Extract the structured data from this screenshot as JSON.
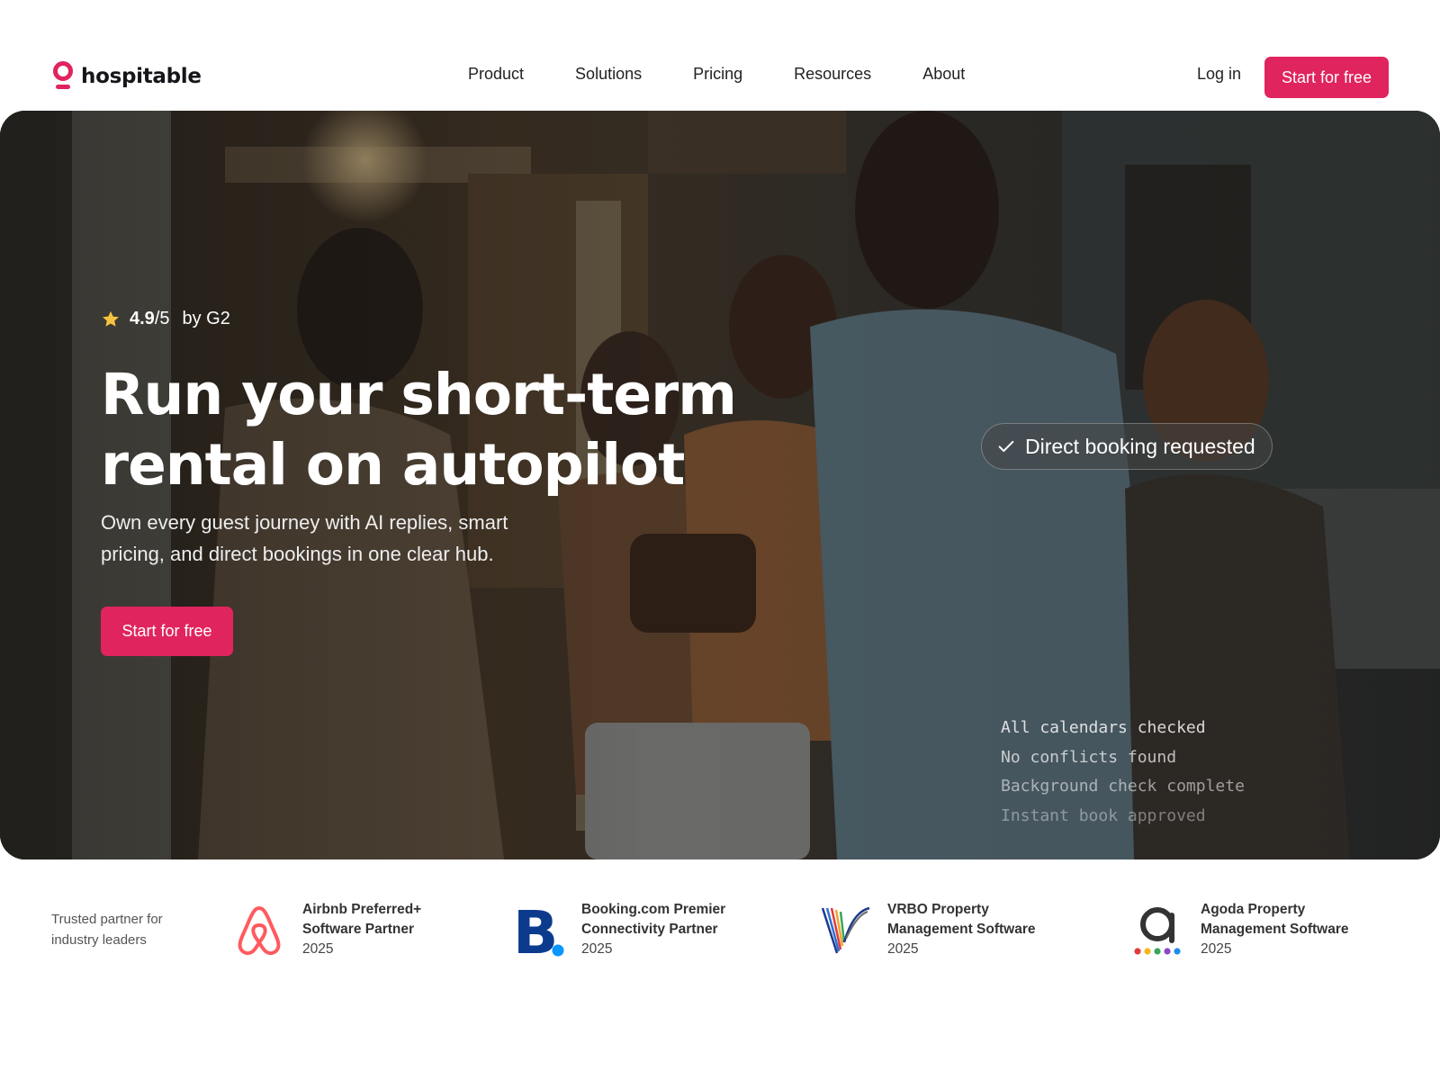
{
  "brand": {
    "name": "hospitable",
    "accent": "#e0245e"
  },
  "nav": {
    "items": [
      {
        "label": "Product"
      },
      {
        "label": "Solutions"
      },
      {
        "label": "Pricing"
      },
      {
        "label": "Resources"
      },
      {
        "label": "About"
      }
    ],
    "login": "Log in",
    "cta": "Start for free"
  },
  "hero": {
    "rating": {
      "score": "4.9",
      "scale": "/5",
      "source": "by G2"
    },
    "headline_line1": "Run your short-term",
    "headline_line2": "rental on autopilot",
    "subtext": "Own every guest journey with AI replies, smart pricing, and direct bookings in one clear hub.",
    "cta": "Start for free",
    "notification": "Direct booking requested",
    "status_lines": [
      "All calendars checked",
      "No conflicts found",
      "Background check complete",
      "Instant book approved"
    ]
  },
  "partners": {
    "intro": "Trusted partner for industry leaders",
    "items": [
      {
        "name_line1": "Airbnb Preferred+",
        "name_line2": "Software Partner",
        "year": "2025",
        "icon": "airbnb-logo"
      },
      {
        "name_line1": "Booking.com Premier",
        "name_line2": "Connectivity Partner",
        "year": "2025",
        "icon": "booking-logo"
      },
      {
        "name_line1": "VRBO Property",
        "name_line2": "Management Software",
        "year": "2025",
        "icon": "vrbo-logo"
      },
      {
        "name_line1": "Agoda Property",
        "name_line2": "Management Software",
        "year": "2025",
        "icon": "agoda-logo"
      }
    ]
  }
}
